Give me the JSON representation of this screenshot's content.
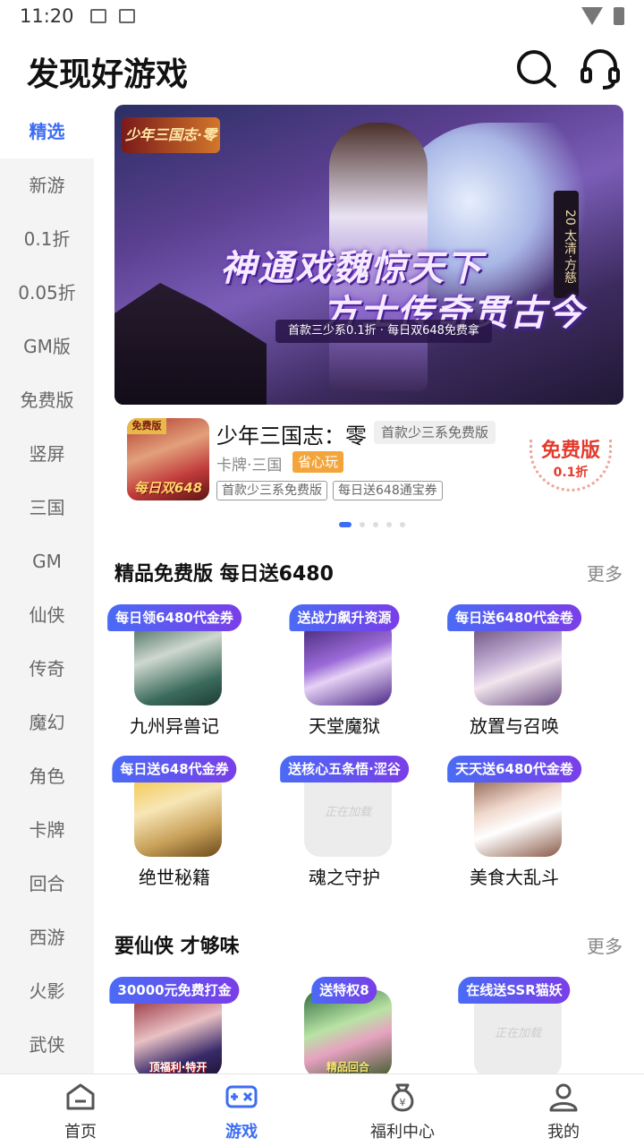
{
  "status": {
    "time": "11:20"
  },
  "header": {
    "title": "发现好游戏"
  },
  "sidebar": {
    "items": [
      {
        "label": "精选"
      },
      {
        "label": "新游"
      },
      {
        "label": "0.1折"
      },
      {
        "label": "0.05折"
      },
      {
        "label": "GM版"
      },
      {
        "label": "免费版"
      },
      {
        "label": "竖屏"
      },
      {
        "label": "三国"
      },
      {
        "label": "GM"
      },
      {
        "label": "仙侠"
      },
      {
        "label": "传奇"
      },
      {
        "label": "魔幻"
      },
      {
        "label": "角色"
      },
      {
        "label": "卡牌"
      },
      {
        "label": "回合"
      },
      {
        "label": "西游"
      },
      {
        "label": "火影"
      },
      {
        "label": "武侠"
      }
    ],
    "active_index": 0
  },
  "banner": {
    "logo": "少年三国志·零",
    "slogan_line1": "神通戏魏惊天下",
    "slogan_line2": "方士传奇贯古今",
    "subline": "首款三少系0.1折 · 每日双648免费拿",
    "vertical_tag": "20 太清·方慈"
  },
  "featured": {
    "name": "少年三国志：零",
    "badge": "首款少三系免费版",
    "category": "卡牌·三国",
    "tag": "省心玩",
    "chips": [
      "首款少三系免费版",
      "每日送648通宝券"
    ],
    "icon_ribbon": "免费版",
    "icon_caption": "每日双648",
    "seal_line1": "免费版",
    "seal_line2": "0.1折"
  },
  "carousel": {
    "count": 5,
    "active": 0
  },
  "section1": {
    "title": "精品免费版 每日送6480",
    "more": "更多",
    "games": [
      {
        "tag": "每日领6480代金券",
        "name": "九州异兽记"
      },
      {
        "tag": "送战力飙升资源",
        "name": "天堂魔狱"
      },
      {
        "tag": "每日送6480代金卷",
        "name": "放置与召唤"
      },
      {
        "tag": "每日送648代金券",
        "name": "绝世秘籍"
      },
      {
        "tag": "送核心五条悟·涩谷",
        "name": "魂之守护",
        "loading": "正在加载"
      },
      {
        "tag": "天天送6480代金卷",
        "name": "美食大乱斗"
      }
    ]
  },
  "section2": {
    "title": "要仙侠 才够味",
    "more": "更多",
    "games": [
      {
        "tag": "30000元免费打金",
        "icon_caption": "顶福利·特开"
      },
      {
        "tag": "送特权8",
        "icon_caption": "精品回合"
      },
      {
        "tag": "在线送SSR猫妖",
        "loading": "正在加载"
      }
    ]
  },
  "tabbar": {
    "items": [
      {
        "label": "首页"
      },
      {
        "label": "游戏"
      },
      {
        "label": "福利中心"
      },
      {
        "label": "我的"
      }
    ],
    "active_index": 1
  },
  "colors": {
    "accent": "#3d6df2",
    "seal": "#e33b2e",
    "tag_orange": "#f3a53b"
  }
}
